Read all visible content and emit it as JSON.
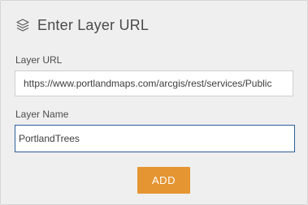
{
  "header": {
    "icon": "layers-icon",
    "title": "Enter Layer URL"
  },
  "form": {
    "url_label": "Layer URL",
    "url_value": "https://www.portlandmaps.com/arcgis/rest/services/Public",
    "name_label": "Layer Name",
    "name_value": "PortlandTrees"
  },
  "actions": {
    "add_label": "ADD"
  },
  "colors": {
    "panel_bg": "#efefef",
    "accent_orange": "#e59532",
    "focus_border": "#2d5f9a"
  }
}
